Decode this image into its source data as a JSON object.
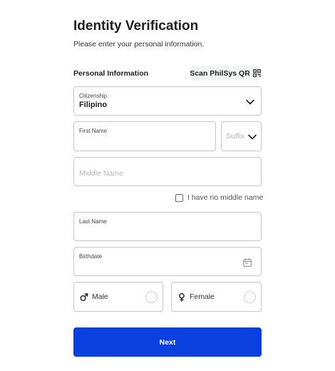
{
  "header": {
    "title": "Identity Verification",
    "subtitle": "Please enter your personal information."
  },
  "section": {
    "label": "Personal Information",
    "scan_button": "Scan PhilSys QR",
    "scan_icon": "qr-code-icon"
  },
  "form": {
    "citizenship": {
      "label": "Citizenship",
      "value": "Filipino"
    },
    "first_name": {
      "label": "First Name",
      "value": ""
    },
    "suffix": {
      "placeholder": "Suffix"
    },
    "middle_name": {
      "placeholder": "Middle Name"
    },
    "no_middle_name": {
      "label": "I have no middle name",
      "checked": false
    },
    "last_name": {
      "label": "Last Name",
      "value": ""
    },
    "birthdate": {
      "label": "Birthdate",
      "value": "",
      "icon": "calendar-icon"
    },
    "gender": {
      "male": {
        "label": "Male",
        "icon": "male-icon",
        "selected": false
      },
      "female": {
        "label": "Female",
        "icon": "female-icon",
        "selected": false
      }
    }
  },
  "actions": {
    "next_label": "Next"
  },
  "colors": {
    "primary": "#0a3fe0",
    "border": "#c8c8c8",
    "placeholder": "#b5b5b5"
  }
}
